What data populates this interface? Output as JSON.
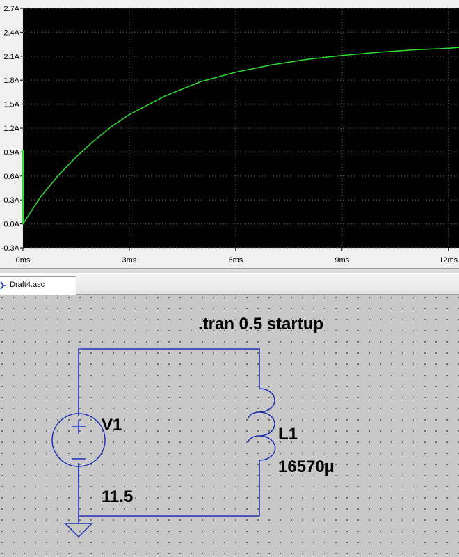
{
  "window": {
    "tab_title": "Draft4.asc"
  },
  "waveform": {
    "y_ticks": [
      "2.7A",
      "2.4A",
      "2.1A",
      "1.8A",
      "1.5A",
      "1.2A",
      "0.9A",
      "0.6A",
      "0.3A",
      "0.0A",
      "-0.3A"
    ],
    "x_ticks": [
      "0ms",
      "3ms",
      "6ms",
      "9ms",
      "12ms"
    ]
  },
  "schematic": {
    "directive": ".tran 0.5 startup",
    "source": {
      "name": "V1",
      "value": "11.5"
    },
    "inductor": {
      "name": "L1",
      "value": "16570µ"
    }
  },
  "chart_data": {
    "type": "line",
    "title": "",
    "xlabel": "",
    "ylabel": "",
    "xlim": [
      0,
      12.3
    ],
    "ylim": [
      -0.3,
      2.7
    ],
    "x_unit": "ms",
    "y_unit": "A",
    "background": "#000000",
    "grid": true,
    "series": [
      {
        "color": "#2ee02e",
        "x": [
          0,
          0.5,
          1,
          1.5,
          2,
          2.5,
          3,
          4,
          5,
          6,
          7,
          8,
          9,
          10,
          11,
          12,
          12.3
        ],
        "y": [
          0,
          0.34,
          0.61,
          0.84,
          1.04,
          1.22,
          1.37,
          1.6,
          1.78,
          1.9,
          1.99,
          2.06,
          2.11,
          2.15,
          2.18,
          2.2,
          2.21
        ]
      },
      {
        "color": "#2ee02e",
        "x": [
          0,
          0
        ],
        "y": [
          0,
          0.92
        ]
      }
    ]
  }
}
